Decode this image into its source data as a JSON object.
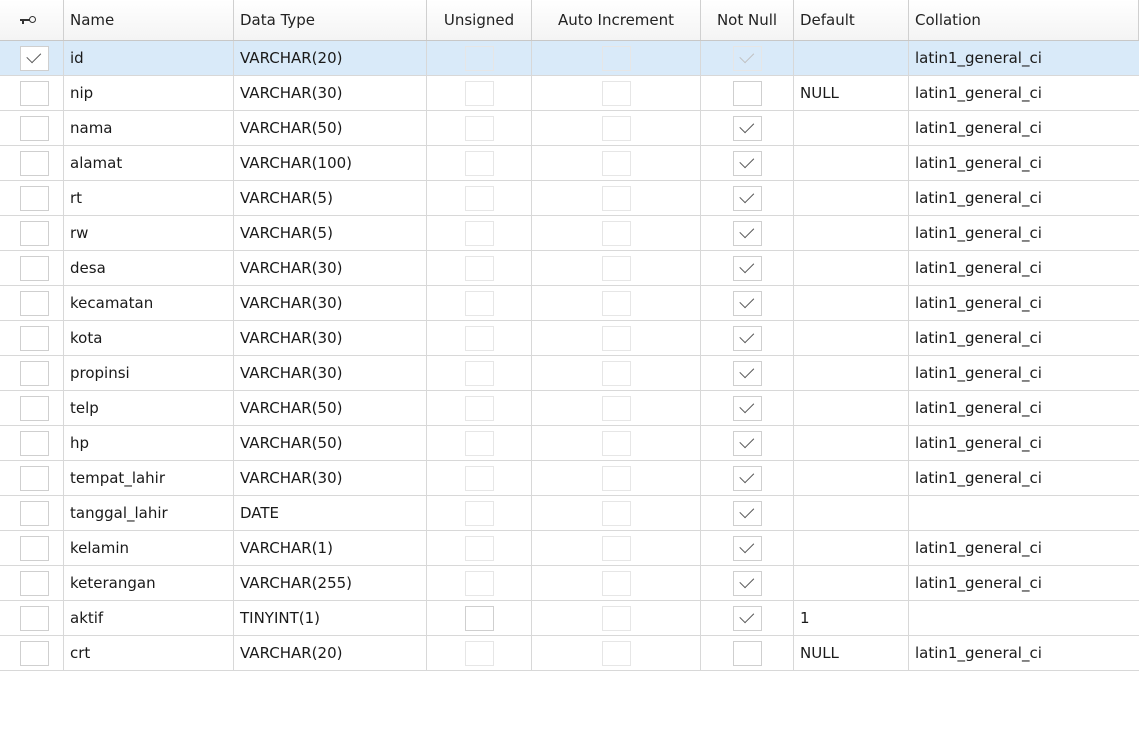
{
  "columns": {
    "key": "",
    "name": "Name",
    "data_type": "Data Type",
    "unsigned": "Unsigned",
    "auto_increment": "Auto Increment",
    "not_null": "Not Null",
    "default": "Default",
    "collation": "Collation"
  },
  "rows": [
    {
      "pk": true,
      "name": "id",
      "type": "VARCHAR(20)",
      "unsigned": false,
      "auto_increment": false,
      "not_null": true,
      "default": "",
      "collation": "latin1_general_ci"
    },
    {
      "pk": false,
      "name": "nip",
      "type": "VARCHAR(30)",
      "unsigned": false,
      "auto_increment": false,
      "not_null": false,
      "default": "NULL",
      "collation": "latin1_general_ci"
    },
    {
      "pk": false,
      "name": "nama",
      "type": "VARCHAR(50)",
      "unsigned": false,
      "auto_increment": false,
      "not_null": true,
      "default": "",
      "collation": "latin1_general_ci"
    },
    {
      "pk": false,
      "name": "alamat",
      "type": "VARCHAR(100)",
      "unsigned": false,
      "auto_increment": false,
      "not_null": true,
      "default": "",
      "collation": "latin1_general_ci"
    },
    {
      "pk": false,
      "name": "rt",
      "type": "VARCHAR(5)",
      "unsigned": false,
      "auto_increment": false,
      "not_null": true,
      "default": "",
      "collation": "latin1_general_ci"
    },
    {
      "pk": false,
      "name": "rw",
      "type": "VARCHAR(5)",
      "unsigned": false,
      "auto_increment": false,
      "not_null": true,
      "default": "",
      "collation": "latin1_general_ci"
    },
    {
      "pk": false,
      "name": "desa",
      "type": "VARCHAR(30)",
      "unsigned": false,
      "auto_increment": false,
      "not_null": true,
      "default": "",
      "collation": "latin1_general_ci"
    },
    {
      "pk": false,
      "name": "kecamatan",
      "type": "VARCHAR(30)",
      "unsigned": false,
      "auto_increment": false,
      "not_null": true,
      "default": "",
      "collation": "latin1_general_ci"
    },
    {
      "pk": false,
      "name": "kota",
      "type": "VARCHAR(30)",
      "unsigned": false,
      "auto_increment": false,
      "not_null": true,
      "default": "",
      "collation": "latin1_general_ci"
    },
    {
      "pk": false,
      "name": "propinsi",
      "type": "VARCHAR(30)",
      "unsigned": false,
      "auto_increment": false,
      "not_null": true,
      "default": "",
      "collation": "latin1_general_ci"
    },
    {
      "pk": false,
      "name": "telp",
      "type": "VARCHAR(50)",
      "unsigned": false,
      "auto_increment": false,
      "not_null": true,
      "default": "",
      "collation": "latin1_general_ci"
    },
    {
      "pk": false,
      "name": "hp",
      "type": "VARCHAR(50)",
      "unsigned": false,
      "auto_increment": false,
      "not_null": true,
      "default": "",
      "collation": "latin1_general_ci"
    },
    {
      "pk": false,
      "name": "tempat_lahir",
      "type": "VARCHAR(30)",
      "unsigned": false,
      "auto_increment": false,
      "not_null": true,
      "default": "",
      "collation": "latin1_general_ci"
    },
    {
      "pk": false,
      "name": "tanggal_lahir",
      "type": "DATE",
      "unsigned": false,
      "auto_increment": false,
      "not_null": true,
      "default": "",
      "collation": ""
    },
    {
      "pk": false,
      "name": "kelamin",
      "type": "VARCHAR(1)",
      "unsigned": false,
      "auto_increment": false,
      "not_null": true,
      "default": "",
      "collation": "latin1_general_ci"
    },
    {
      "pk": false,
      "name": "keterangan",
      "type": "VARCHAR(255)",
      "unsigned": false,
      "auto_increment": false,
      "not_null": true,
      "default": "",
      "collation": "latin1_general_ci"
    },
    {
      "pk": false,
      "name": "aktif",
      "type": "TINYINT(1)",
      "unsigned": false,
      "auto_increment": false,
      "not_null": true,
      "default": "1",
      "collation": ""
    },
    {
      "pk": false,
      "name": "crt",
      "type": "VARCHAR(20)",
      "unsigned": false,
      "auto_increment": false,
      "not_null": false,
      "default": "NULL",
      "collation": "latin1_general_ci"
    }
  ],
  "selected_row": 0,
  "colors": {
    "selection": "#d9eaf9",
    "grid_line": "#d8d8d8",
    "check": "#555555"
  }
}
